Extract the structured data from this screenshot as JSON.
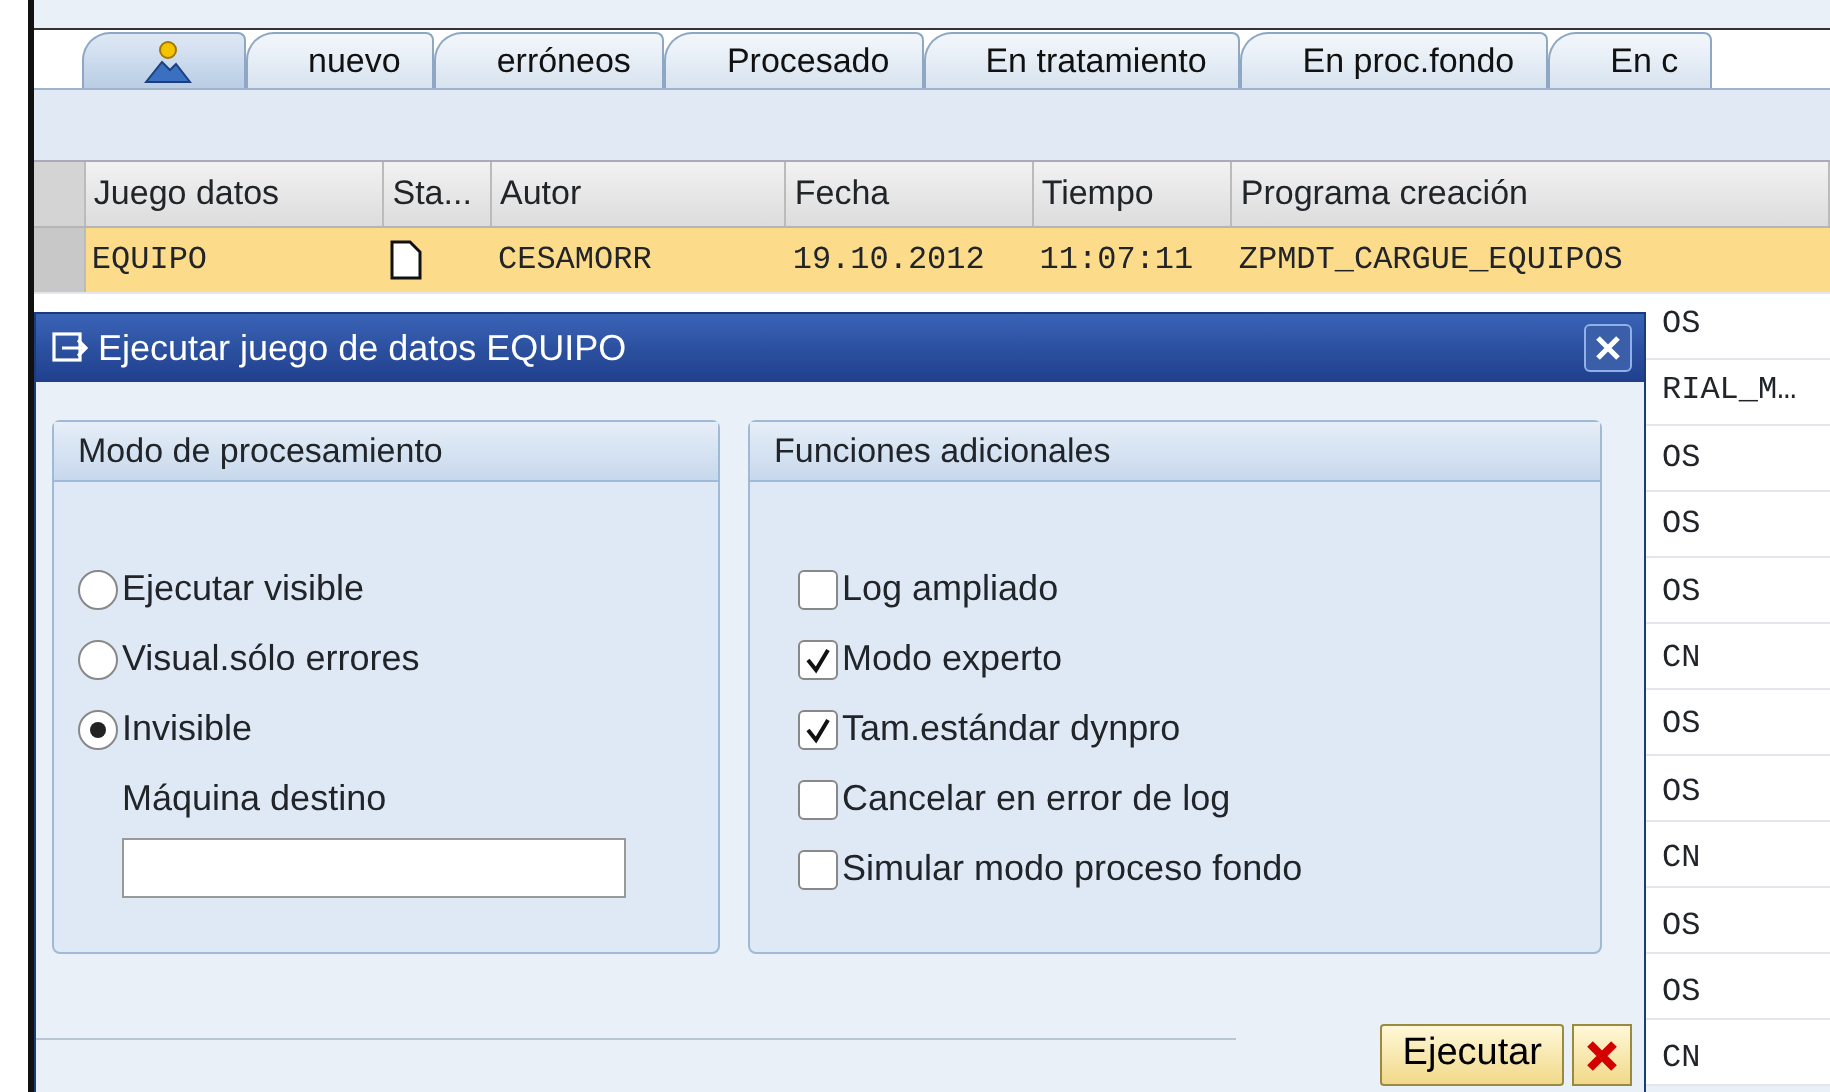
{
  "tabs": [
    {
      "kind": "icon",
      "selected": true
    },
    {
      "kind": "text",
      "label": "nuevo",
      "selected": false
    },
    {
      "kind": "text",
      "label": "erróneos",
      "selected": false
    },
    {
      "kind": "text",
      "label": "Procesado",
      "selected": false
    },
    {
      "kind": "text",
      "label": "En tratamiento",
      "selected": false
    },
    {
      "kind": "text",
      "label": "En proc.fondo",
      "selected": false
    },
    {
      "kind": "text",
      "label": "En c",
      "selected": false
    }
  ],
  "table": {
    "columns": [
      "Juego datos",
      "Sta...",
      "Autor",
      "Fecha",
      "Tiempo",
      "Programa creación"
    ],
    "rows": [
      {
        "selected": true,
        "cells": [
          "EQUIPO",
          "",
          "CESAMORR",
          "19.10.2012",
          "11:07:11",
          "ZPMDT_CARGUE_EQUIPOS"
        ]
      }
    ],
    "covered_row_endings": [
      "OS",
      "RIAL_M…",
      "OS",
      "OS",
      "OS",
      "CN",
      "OS",
      "OS",
      "CN",
      "OS",
      "OS",
      "CN"
    ]
  },
  "dialog": {
    "title": "Ejecutar juego de datos EQUIPO",
    "processing_mode": {
      "title": "Modo de procesamiento",
      "options": [
        {
          "label": "Ejecutar visible",
          "selected": false
        },
        {
          "label": "Visual.sólo errores",
          "selected": false
        },
        {
          "label": "Invisible",
          "selected": true
        }
      ],
      "target_label": "Máquina destino"
    },
    "additional_functions": {
      "title": "Funciones adicionales",
      "options": [
        {
          "label": "Log ampliado",
          "checked": false
        },
        {
          "label": "Modo experto",
          "checked": true
        },
        {
          "label": "Tam.estándar dynpro",
          "checked": true
        },
        {
          "label": "Cancelar en error de log",
          "checked": false
        },
        {
          "label": "Simular modo proceso fondo",
          "checked": false
        }
      ]
    },
    "buttons": [
      "Ejecutar"
    ]
  }
}
